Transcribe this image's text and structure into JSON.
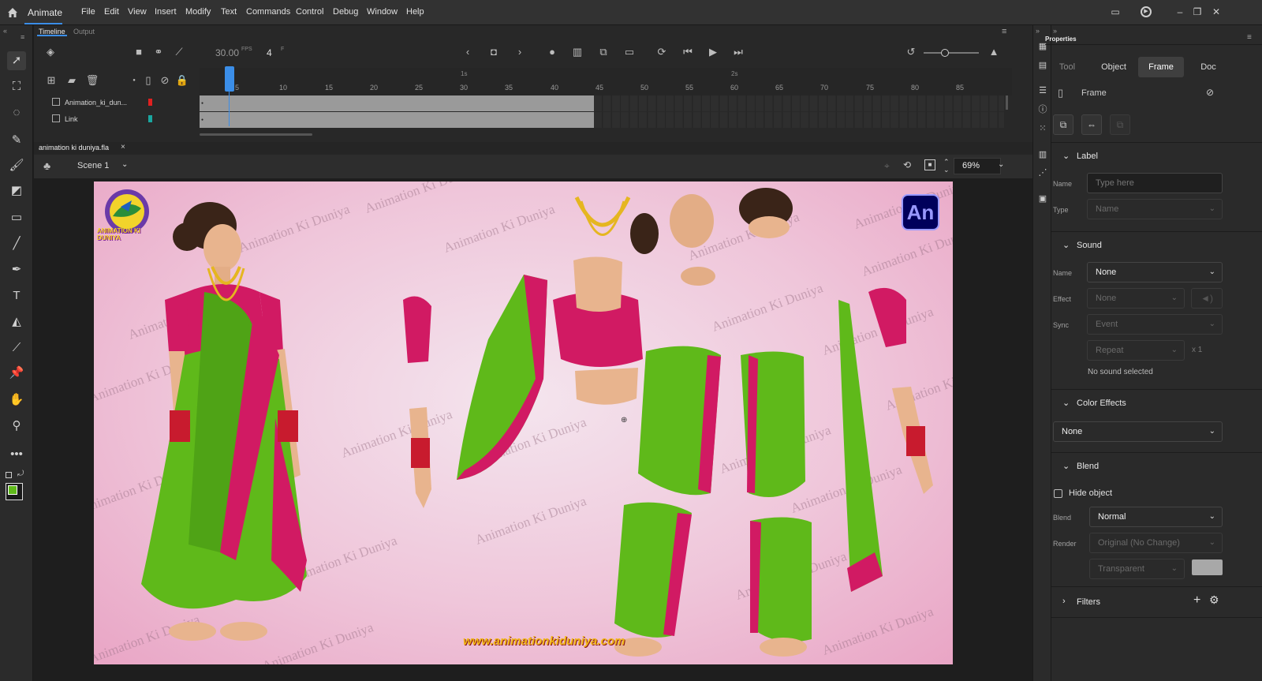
{
  "app": {
    "name": "Animate"
  },
  "menu": [
    "File",
    "Edit",
    "View",
    "Insert",
    "Modify",
    "Text",
    "Commands",
    "Control",
    "Debug",
    "Window",
    "Help"
  ],
  "timeline": {
    "tabs": [
      "Timeline",
      "Output"
    ],
    "fps": "30.00",
    "fps_unit": "FPS",
    "frame": "4",
    "frame_unit": "F",
    "ruler_seconds": [
      "1s",
      "2s"
    ],
    "ruler_numbers": [
      "5",
      "10",
      "15",
      "20",
      "25",
      "30",
      "35",
      "40",
      "45",
      "50",
      "55",
      "60",
      "65",
      "70",
      "75",
      "80",
      "85"
    ],
    "layers": [
      {
        "name": "Animation_ki_dun...",
        "color": "#e02020"
      },
      {
        "name": "Link",
        "color": "#1aa7a0"
      }
    ]
  },
  "document": {
    "tab": "animation ki duniya.fla",
    "close": "×",
    "scene": "Scene 1",
    "zoom": "69%"
  },
  "stage": {
    "watermark": "Animation Ki Duniya",
    "badge": "An",
    "logo_text": "ANIMATION KI DUNIYA",
    "url": "www.animationkiduniya.com"
  },
  "properties": {
    "title": "Properties",
    "tabs": [
      "Tool",
      "Object",
      "Frame",
      "Doc"
    ],
    "active_tab": "Frame",
    "frame_header": "Frame",
    "label": {
      "title": "Label",
      "name_label": "Name",
      "name_placeholder": "Type here",
      "type_label": "Type",
      "type_value": "Name"
    },
    "sound": {
      "title": "Sound",
      "name_label": "Name",
      "name_value": "None",
      "effect_label": "Effect",
      "effect_value": "None",
      "sync_label": "Sync",
      "sync_value": "Event",
      "repeat_value": "Repeat",
      "repeat_count": "x 1",
      "status": "No sound selected"
    },
    "color_effects": {
      "title": "Color Effects",
      "value": "None"
    },
    "blend": {
      "title": "Blend",
      "hide_object": "Hide object",
      "blend_label": "Blend",
      "blend_value": "Normal",
      "render_label": "Render",
      "render_value": "Original (No Change)",
      "transparent_value": "Transparent"
    },
    "filters": {
      "title": "Filters"
    }
  },
  "colors": {
    "accent": "#3b8ee8",
    "saree_green": "#5fb91a",
    "saree_pink": "#d11a63",
    "stage_bg": "#efc6da"
  }
}
